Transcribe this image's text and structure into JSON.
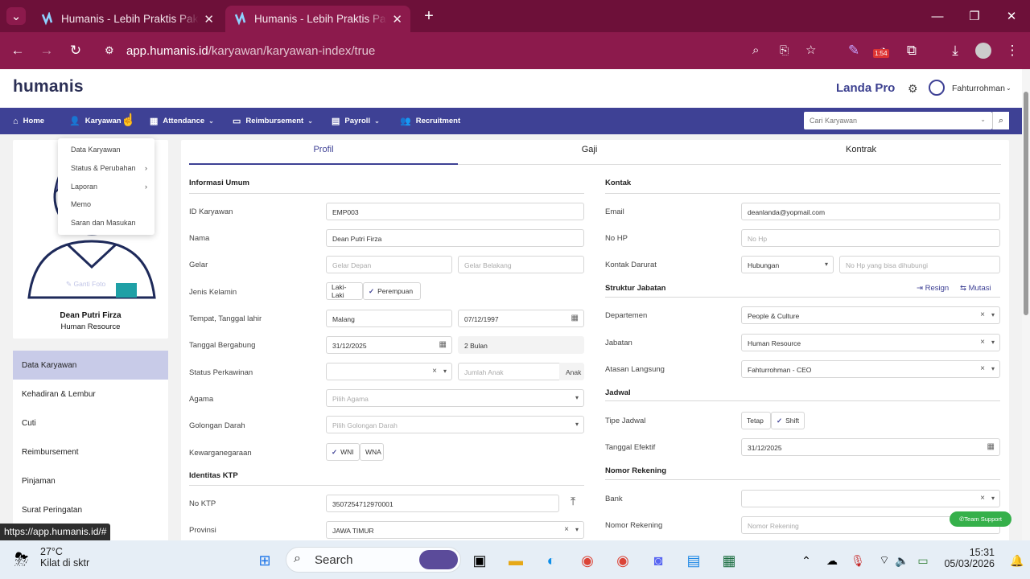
{
  "browser": {
    "tabs": [
      {
        "title": "Humanis - Lebih Praktis Pakai Humanis"
      },
      {
        "title": "Humanis - Lebih Praktis Pakai Humanis"
      }
    ],
    "url_host": "app.humanis.id",
    "url_path": "/karyawan/karyawan-index/true",
    "status_url": "https://app.humanis.id/#",
    "badge_time": "1:54"
  },
  "header": {
    "logo": "humanis",
    "company": "Landa Pro",
    "user": "Fahturrohman"
  },
  "nav": {
    "items": [
      {
        "label": "Home"
      },
      {
        "label": "Karyawan"
      },
      {
        "label": "Attendance"
      },
      {
        "label": "Reimbursement"
      },
      {
        "label": "Payroll"
      },
      {
        "label": "Recruitment"
      }
    ],
    "search_placeholder": "Cari Karyawan"
  },
  "dropdown": [
    "Data Karyawan",
    "Status & Perubahan",
    "Laporan",
    "Memo",
    "Saran dan Masukan"
  ],
  "profile": {
    "name": "Dean Putri Firza",
    "role": "Human Resource",
    "photo_label": "Ganti Foto"
  },
  "sidebar": [
    "Data Karyawan",
    "Kehadiran & Lembur",
    "Cuti",
    "Reimbursement",
    "Pinjaman",
    "Surat Peringatan"
  ],
  "tabs": [
    "Profil",
    "Gaji",
    "Kontrak"
  ],
  "left": {
    "sec_info": "Informasi Umum",
    "id_label": "ID Karyawan",
    "id_value": "EMP003",
    "nama_label": "Nama",
    "nama_value": "Dean Putri Firza",
    "gelar_label": "Gelar",
    "gelar_depan_ph": "Gelar Depan",
    "gelar_belakang_ph": "Gelar Belakang",
    "jk_label": "Jenis Kelamin",
    "jk_opt1": "Laki-Laki",
    "jk_opt2": "Perempuan",
    "ttl_label": "Tempat, Tanggal lahir",
    "ttl_place": "Malang",
    "ttl_date": "07/12/1997",
    "tb_label": "Tanggal Bergabung",
    "tb_date": "31/12/2025",
    "tb_duration": "2 Bulan",
    "sp_label": "Status Perkawinan",
    "anak_ph": "Jumlah Anak",
    "anak_suffix": "Anak",
    "agama_label": "Agama",
    "agama_ph": "Pilih Agama",
    "gd_label": "Golongan Darah",
    "gd_ph": "Pilih Golongan Darah",
    "kw_label": "Kewarganegaraan",
    "kw_opt1": "WNI",
    "kw_opt2": "WNA",
    "sec_ktp": "Identitas KTP",
    "ktp_label": "No KTP",
    "ktp_value": "3507254712970001",
    "prov_label": "Provinsi",
    "prov_value": "JAWA TIMUR"
  },
  "right": {
    "sec_kontak": "Kontak",
    "email_label": "Email",
    "email_value": "deanlanda@yopmail.com",
    "hp_label": "No HP",
    "hp_ph": "No Hp",
    "kd_label": "Kontak Darurat",
    "kd_rel": "Hubungan",
    "kd_ph": "No Hp yang bisa dihubungi",
    "sec_struktur": "Struktur Jabatan",
    "resign": "Resign",
    "mutasi": "Mutasi",
    "dept_label": "Departemen",
    "dept_value": "People & Culture",
    "jab_label": "Jabatan",
    "jab_value": "Human Resource",
    "atasan_label": "Atasan Langsung",
    "atasan_value": "Fahturrohman - CEO",
    "sec_jadwal": "Jadwal",
    "tipe_label": "Tipe Jadwal",
    "tipe_opt1": "Tetap",
    "tipe_opt2": "Shift",
    "te_label": "Tanggal Efektif",
    "te_value": "31/12/2025",
    "sec_rek": "Nomor Rekening",
    "bank_label": "Bank",
    "norek_label": "Nomor Rekening",
    "norek_ph": "Nomor Rekening"
  },
  "support": "Team Support",
  "taskbar": {
    "temp": "27°C",
    "weather": "Kilat di sktr",
    "search": "Search",
    "time": "15:31",
    "date": "05/03/2026"
  }
}
